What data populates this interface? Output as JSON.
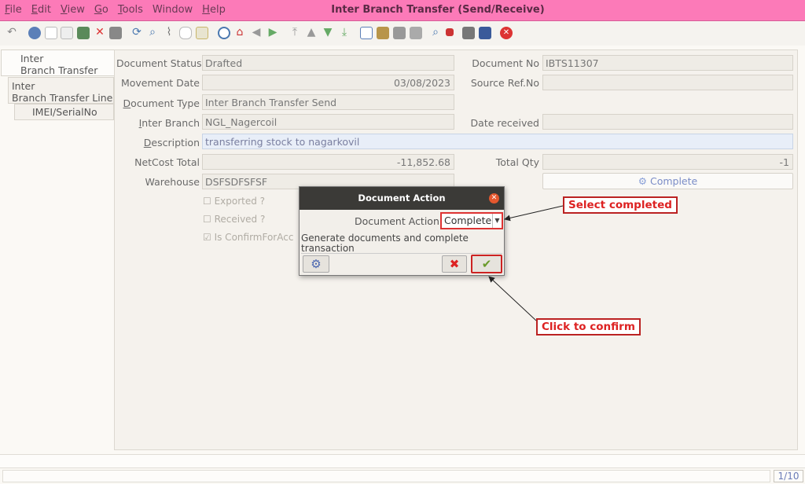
{
  "app": {
    "window_title": "Inter Branch Transfer (Send/Receive)",
    "menu": [
      {
        "ul": "F",
        "rest": "ile"
      },
      {
        "ul": "E",
        "rest": "dit"
      },
      {
        "ul": "V",
        "rest": "iew"
      },
      {
        "ul": "G",
        "rest": "o"
      },
      {
        "ul": "T",
        "rest": "ools"
      },
      {
        "ul": "",
        "rest": "Window"
      },
      {
        "ul": "H",
        "rest": "elp"
      }
    ]
  },
  "tabs": [
    {
      "line1": "Inter",
      "line2": "Branch Transfer"
    },
    {
      "line1": "Inter",
      "line2": "Branch Transfer Line"
    },
    {
      "line1": "IMEI/SerialNo",
      "line2": ""
    }
  ],
  "form": {
    "document_status": {
      "label": "Document Status",
      "value": "Drafted"
    },
    "document_no": {
      "label": "Document No",
      "value": "IBTS11307"
    },
    "movement_date": {
      "label": "Movement Date",
      "value": "03/08/2023"
    },
    "source_ref_no": {
      "label": "Source Ref.No",
      "value": ""
    },
    "document_type": {
      "label_ul": "D",
      "label_rest": "ocument Type",
      "value": "Inter Branch Transfer Send"
    },
    "inter_branch": {
      "label_ul": "I",
      "label_rest": "nter Branch",
      "value": "NGL_Nagercoil"
    },
    "date_received": {
      "label": "Date received",
      "value": ""
    },
    "description": {
      "label_ul": "D",
      "label_rest": "escription",
      "value": "transferring stock to nagarkovil"
    },
    "netcost_total": {
      "label": "NetCost Total",
      "value": "-11,852.68"
    },
    "total_qty": {
      "label": "Total Qty",
      "value": "-1"
    },
    "warehouse": {
      "label": "Warehouse",
      "value": "DSFSDFSFSF"
    },
    "complete_button": "Complete",
    "exported": "Exported ?",
    "received": "Received ?",
    "is_confirm": "Is ConfirmForAcc"
  },
  "dialog": {
    "title": "Document Action",
    "action_label": "Document Action",
    "action_value": "Complete",
    "description": "Generate documents and complete transaction"
  },
  "annotations": {
    "select_completed": "Select completed",
    "click_to_confirm": "Click to confirm"
  },
  "status": {
    "page": "1/10"
  },
  "colors": {
    "title_bar": "#fc7ab8",
    "callout_border": "#b22222",
    "complete_text": "#7a8cc7"
  },
  "icons": [
    "undo-icon",
    "help-icon",
    "new-icon",
    "copy-icon",
    "save-icon",
    "delete-icon",
    "grid-icon",
    "refresh-icon",
    "find-icon",
    "attachment-icon",
    "chat-icon",
    "history-icon",
    "home-icon",
    "previous-icon",
    "next-icon",
    "first-record-icon",
    "previous-record-icon",
    "next-record-icon",
    "last-record-icon",
    "report-icon",
    "archive-icon",
    "print-icon",
    "print-preview-icon",
    "zoom-icon",
    "workflow-icon",
    "request-icon",
    "product-info-icon",
    "close-window-icon"
  ]
}
